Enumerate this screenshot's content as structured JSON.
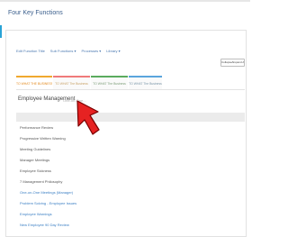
{
  "page": {
    "title": "Four Key Functions"
  },
  "toolbar": {
    "items": [
      "Edit Function Title",
      "Sub Functions ▾",
      "Processes ▾",
      "Library ▾"
    ],
    "collapse_label": "Collapse/Expand All"
  },
  "tabs": [
    {
      "label": "TO WHAT THE BUSINESS"
    },
    {
      "label": "TO WHAT The Business"
    },
    {
      "label": "TO WHAT The Business"
    },
    {
      "label": "TO WHAT The Business"
    }
  ],
  "section": {
    "label": "Employee Management",
    "placeholder": "One-on-One..."
  },
  "list": [
    {
      "label": "Performance Review",
      "color": "#555555"
    },
    {
      "label": "Progressive Written Warning",
      "color": "#555555"
    },
    {
      "label": "Meeting Guidelines",
      "color": "#555555"
    },
    {
      "label": "Manager Meetings",
      "color": "#555555"
    },
    {
      "label": "Employee Sickness",
      "color": "#555555"
    },
    {
      "label": "7 Management Philosophy",
      "color": "#555555"
    },
    {
      "label": "One-on-One Meetings (Manager)",
      "color": "#3b7fc4"
    },
    {
      "label": "Problem Solving - Employee Issues",
      "color": "#3b7fc4"
    },
    {
      "label": "Employee Warnings",
      "color": "#3b7fc4"
    },
    {
      "label": "New Employee 90 Day Review",
      "color": "#3b7fc4"
    }
  ],
  "colors": {
    "accent": "#29a3d6",
    "cursor": "#e62222"
  }
}
